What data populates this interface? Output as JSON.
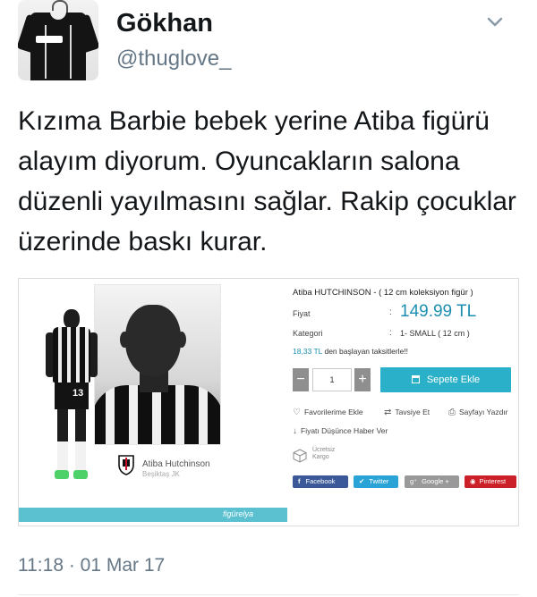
{
  "tweet": {
    "author_name": "Gökhan",
    "author_handle": "@thuglove_",
    "text": "Kızıma Barbie bebek yerine Atiba figürü alayım diyorum. Oyuncakların salona düzenli yayılmasını sağlar. Rakip çocuklar üzerinde baskı kurar.",
    "timestamp": "11:18 · 01 Mar 17",
    "menu_icon": "chevron-down-icon"
  },
  "product": {
    "title": "Atiba HUTCHINSON - ( 12 cm koleksiyon figür )",
    "price_label": "Fiyat",
    "price_value": "149.99 TL",
    "category_label": "Kategori",
    "category_value": "1- SMALL ( 12 cm )",
    "installment_amount": "18,33 TL",
    "installment_text": "den başlayan taksitlerle!!",
    "quantity": "1",
    "add_to_cart": "Sepete Ekle",
    "favorites": "Favorilerime Ekle",
    "recommend": "Tavsiye Et",
    "print": "Sayfayı Yazdır",
    "price_alert": "Fiyatı Düşünce Haber Ver",
    "shipping": [
      "Ücretsiz",
      "Kargo"
    ],
    "signature_name": "Atiba Hutchinson",
    "signature_club": "Beşiktaş JK",
    "brand": "figürelya",
    "jersey_number": "13",
    "colon": ":"
  },
  "share": {
    "facebook": "Facebook",
    "twitter": "Twitter",
    "google": "Google +",
    "pinterest": "Pinterest"
  },
  "colors": {
    "price": "#1c8fb0",
    "cart_button": "#2ab0c8",
    "facebook": "#3b5998",
    "twitter": "#2aa3d6",
    "google": "#999999",
    "pinterest": "#cb2027"
  }
}
